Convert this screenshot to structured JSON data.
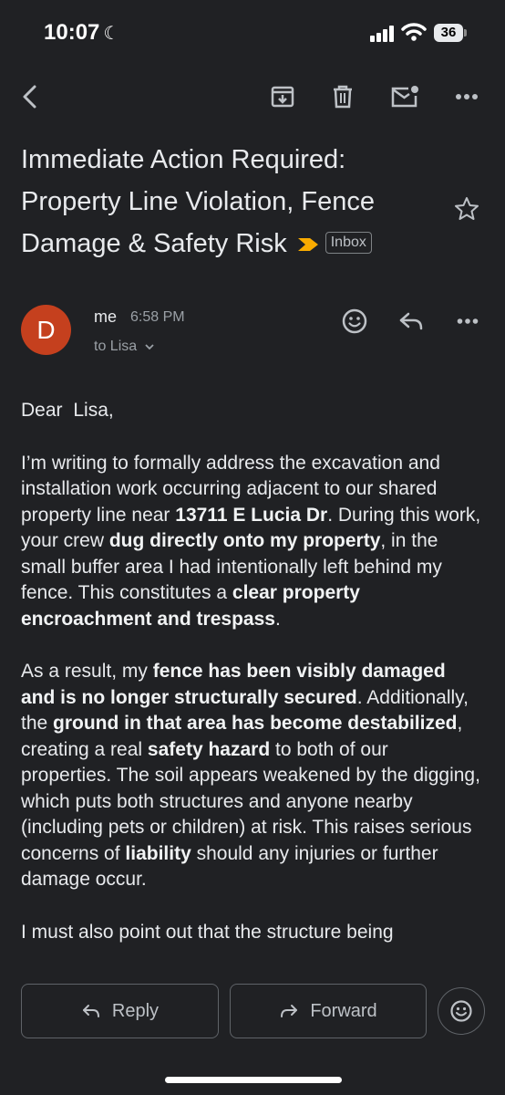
{
  "status_bar": {
    "time": "10:07",
    "battery": "36"
  },
  "toolbar": {
    "back": "back-arrow-icon",
    "archive": "archive-icon",
    "delete": "trash-icon",
    "mark_unread": "mail-unread-icon",
    "more": "more-horizontal-icon"
  },
  "email": {
    "subject": "Immediate Action Required: Property Line Violation, Fence Damage & Safety Risk",
    "label": "Inbox",
    "sender": {
      "avatar_letter": "D",
      "name": "me",
      "time": "6:58 PM",
      "recipient": "to Lisa"
    },
    "body": {
      "greeting": "Dear  Lisa,",
      "p1": {
        "t1": "I’m writing to formally address the excavation and installation work occurring adjacent to our shared property line near ",
        "b1": "13711 E Lucia Dr",
        "t2": ". During this work, your crew ",
        "b2": "dug directly onto my property",
        "t3": ", in the small buffer area I had intentionally left behind my fence. This constitutes a ",
        "b3": "clear property encroachment and trespass",
        "t4": "."
      },
      "p2": {
        "t1": "As a result, my ",
        "b1": "fence has been visibly damaged and is no longer structurally secured",
        "t2": ". Additionally, the ",
        "b2": "ground in that area has become destabilized",
        "t3": ", creating a real ",
        "b3": "safety hazard",
        "t4": " to both of our properties. The soil appears weakened by the digging, which puts both structures and anyone nearby (including pets or children) at risk. This raises serious concerns of ",
        "b4": "liability",
        "t5": " should any injuries or further damage occur."
      },
      "p3": "I must also point out that the structure being"
    }
  },
  "actions": {
    "reply": "Reply",
    "forward": "Forward"
  },
  "colors": {
    "background": "#202124",
    "avatar": "#c5401e",
    "importance": "#f9ab00"
  }
}
